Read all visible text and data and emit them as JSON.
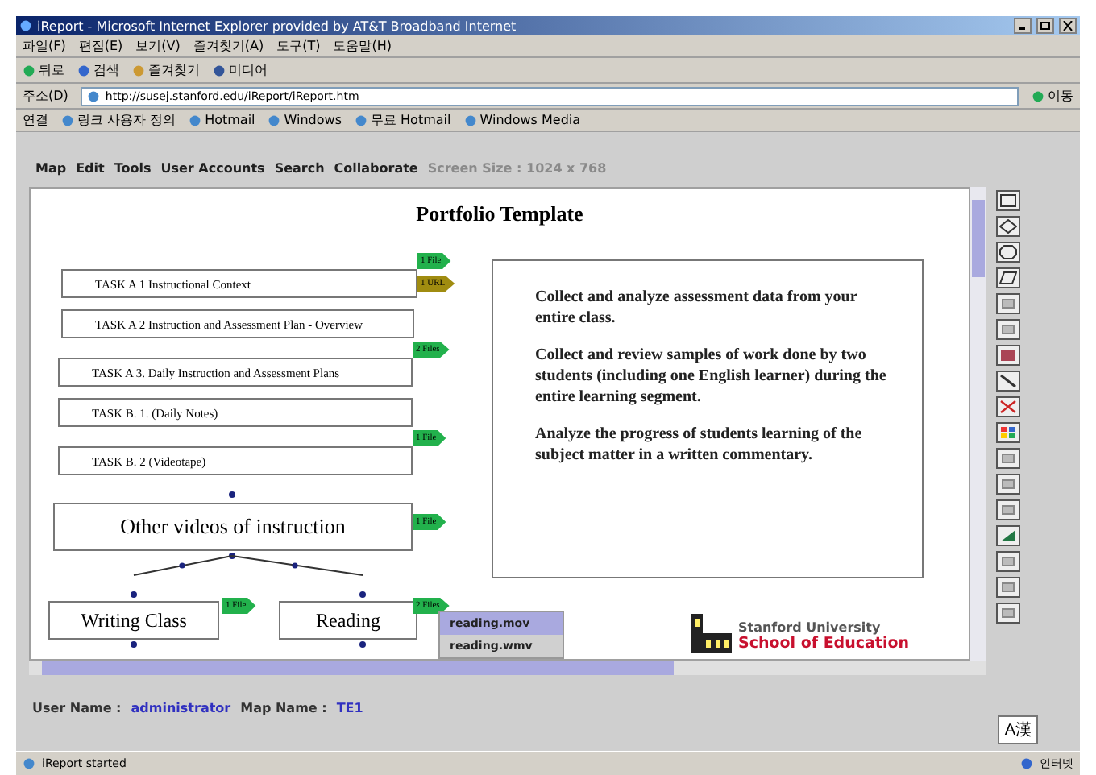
{
  "window": {
    "title": "iReport - Microsoft Internet Explorer provided by AT&T Broadband Internet"
  },
  "menu": [
    "파일(F)",
    "편집(E)",
    "보기(V)",
    "즐겨찾기(A)",
    "도구(T)",
    "도움말(H)"
  ],
  "toolbar": [
    "뒤로",
    "검색",
    "즐겨찾기",
    "미디어"
  ],
  "address": {
    "label": "주소(D)",
    "value": "http://susej.stanford.edu/iReport/iReport.htm",
    "go": "이동"
  },
  "links": {
    "label": "연결",
    "items": [
      "링크 사용자 정의",
      "Hotmail",
      "Windows",
      "무료 Hotmail",
      "Windows Media"
    ]
  },
  "app_menu": [
    {
      "label": "Map",
      "disabled": false
    },
    {
      "label": "Edit",
      "disabled": false
    },
    {
      "label": "Tools",
      "disabled": false
    },
    {
      "label": "User Accounts",
      "disabled": false
    },
    {
      "label": "Search",
      "disabled": false
    },
    {
      "label": "Collaborate",
      "disabled": false
    },
    {
      "label": "Screen Size : 1024 x 768",
      "disabled": true
    }
  ],
  "canvas": {
    "title": "Portfolio Template",
    "tasks": [
      "TASK A 1 Instructional Context",
      "TASK A 2 Instruction and Assessment Plan - Overview",
      "TASK A 3. Daily Instruction and Assessment Plans",
      "TASK B. 1. (Daily Notes)",
      "TASK B. 2 (Videotape)"
    ],
    "tags": [
      {
        "text": "1 File",
        "color": "#22b14c"
      },
      {
        "text": "1 URL",
        "color": "#a08c10"
      },
      {
        "text": "2 Files",
        "color": "#22b14c"
      },
      {
        "text": "1 File",
        "color": "#22b14c"
      },
      {
        "text": "1 File",
        "color": "#22b14c"
      },
      {
        "text": "1 File",
        "color": "#22b14c"
      },
      {
        "text": "2 Files",
        "color": "#22b14c"
      }
    ],
    "nodes": [
      "Other videos of instruction",
      "Writing Class",
      "Reading"
    ],
    "popup": [
      {
        "label": "reading.mov",
        "selected": true
      },
      {
        "label": "reading.wmv",
        "selected": false
      }
    ],
    "description": [
      "Collect and analyze assessment data from your entire class.",
      "Collect and review samples of work done by two students (including one English learner) during the entire learning segment.",
      "Analyze the progress of students learning of the subject matter in a written commentary."
    ],
    "logo": {
      "line1": "Stanford University",
      "line2": "School of Education"
    }
  },
  "user": {
    "user_label": "User Name :",
    "user_value": "administrator",
    "map_label": "Map Name :",
    "map_value": "TE1"
  },
  "ime": "A漢",
  "status": {
    "text": "iReport started",
    "zone": "인터넷"
  }
}
